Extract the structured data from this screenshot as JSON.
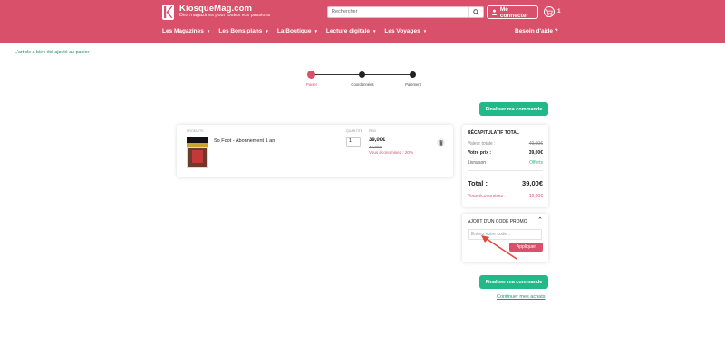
{
  "header": {
    "logo_title": "KiosqueMag.com",
    "logo_tagline": "Des magazines pour toutes vos passions",
    "search_placeholder": "Rechercher",
    "account_label": "Me connecter",
    "cart_count": "1",
    "brand_color": "#d8506a"
  },
  "nav": {
    "items": [
      {
        "label": "Les Magazines",
        "has_caret": true
      },
      {
        "label": "Les Bons plans",
        "has_caret": true
      },
      {
        "label": "La Boutique",
        "has_caret": true
      },
      {
        "label": "Lecture digitale",
        "has_caret": true
      },
      {
        "label": "Les Voyages",
        "has_caret": true
      }
    ],
    "help_label": "Besoin d'aide ?"
  },
  "notice": "L'article a bien été ajouté au panier",
  "steps": [
    {
      "label": "Panier",
      "active": true
    },
    {
      "label": "Coordonnées",
      "active": false
    },
    {
      "label": "Paiement",
      "active": false
    }
  ],
  "cart": {
    "columns": {
      "product": "PRODUITS",
      "quantity": "QUANTITÉ",
      "price": "PRIX"
    },
    "item": {
      "title": "So Foot - Abonnement 1 an",
      "quantity": "1",
      "price": "39,00€",
      "old_price": "49,00€",
      "savings": "Vous économisez : 20%"
    }
  },
  "actions": {
    "checkout_label": "Finaliser ma commande",
    "continue_label": "Continuer mes achats",
    "accent_color": "#22b887"
  },
  "summary": {
    "title": "RÉCAPITULATIF TOTAL",
    "rows": {
      "subtotal_label": "Valeur totale :",
      "subtotal_value": "49,00€",
      "your_price_label": "Votre prix :",
      "your_price_value": "39,00€",
      "delivery_label": "Livraison :",
      "delivery_value": "Offerts",
      "total_label": "Total :",
      "total_value": "39,00€",
      "savings_label": "Vous économisez :",
      "savings_value": "10,00€"
    }
  },
  "promo": {
    "title": "AJOUT D'UN CODE PROMO",
    "input_placeholder": "Entrez votre code...",
    "apply_label": "Appliquer"
  }
}
